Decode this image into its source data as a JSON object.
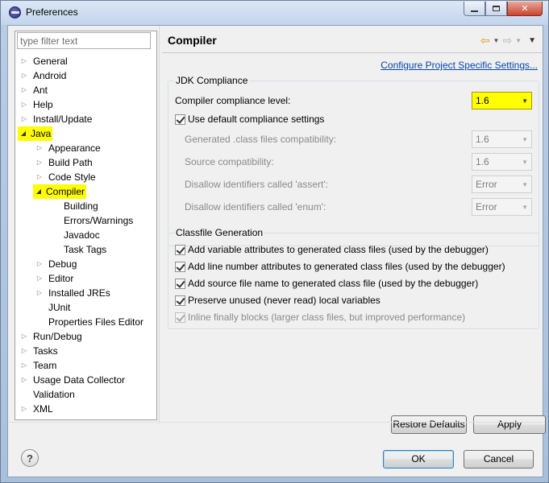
{
  "window": {
    "title": "Preferences",
    "minimize_glyph": "▭",
    "maximize_glyph": "▭",
    "close_glyph": "✕"
  },
  "filter": {
    "placeholder": "type filter text"
  },
  "tree": {
    "items": [
      {
        "label": "General",
        "expander": "▷"
      },
      {
        "label": "Android",
        "expander": "▷"
      },
      {
        "label": "Ant",
        "expander": "▷"
      },
      {
        "label": "Help",
        "expander": "▷"
      },
      {
        "label": "Install/Update",
        "expander": "▷"
      },
      {
        "label": "Java",
        "expander": "◢"
      },
      {
        "label": "Appearance",
        "expander": "▷"
      },
      {
        "label": "Build Path",
        "expander": "▷"
      },
      {
        "label": "Code Style",
        "expander": "▷"
      },
      {
        "label": "Compiler",
        "expander": "◢"
      },
      {
        "label": "Building"
      },
      {
        "label": "Errors/Warnings"
      },
      {
        "label": "Javadoc"
      },
      {
        "label": "Task Tags"
      },
      {
        "label": "Debug",
        "expander": "▷"
      },
      {
        "label": "Editor",
        "expander": "▷"
      },
      {
        "label": "Installed JREs",
        "expander": "▷"
      },
      {
        "label": "JUnit"
      },
      {
        "label": "Properties Files Editor"
      },
      {
        "label": "Run/Debug",
        "expander": "▷"
      },
      {
        "label": "Tasks",
        "expander": "▷"
      },
      {
        "label": "Team",
        "expander": "▷"
      },
      {
        "label": "Usage Data Collector",
        "expander": "▷"
      },
      {
        "label": "Validation"
      },
      {
        "label": "XML",
        "expander": "▷"
      }
    ],
    "highlight_color": "#ffff00"
  },
  "page": {
    "title": "Compiler",
    "back_icon": "⇦",
    "forward_icon": "⇨",
    "menu_caret": "▼",
    "config_link": "Configure Project Specific Settings..."
  },
  "jdk": {
    "group_title": "JDK Compliance",
    "compliance_label": "Compiler compliance level:",
    "compliance_value": "1.6",
    "use_default_label": "Use default compliance settings",
    "use_default_checked": true,
    "rows": [
      {
        "label": "Generated .class files compatibility:",
        "value": "1.6"
      },
      {
        "label": "Source compatibility:",
        "value": "1.6"
      },
      {
        "label": "Disallow identifiers called 'assert':",
        "value": "Error"
      },
      {
        "label": "Disallow identifiers called 'enum':",
        "value": "Error"
      }
    ]
  },
  "classfile": {
    "group_title": "Classfile Generation",
    "options": [
      {
        "label": "Add variable attributes to generated class files (used by the debugger)",
        "checked": true,
        "enabled": true
      },
      {
        "label": "Add line number attributes to generated class files (used by the debugger)",
        "checked": true,
        "enabled": true
      },
      {
        "label": "Add source file name to generated class file (used by the debugger)",
        "checked": true,
        "enabled": true
      },
      {
        "label": "Preserve unused (never read) local variables",
        "checked": true,
        "enabled": true
      },
      {
        "label": "Inline finally blocks (larger class files, but improved performance)",
        "checked": true,
        "enabled": false
      }
    ]
  },
  "buttons": {
    "restore_defaults": "Restore Defaults",
    "apply": "Apply",
    "ok": "OK",
    "cancel": "Cancel",
    "help": "?"
  },
  "colors": {
    "highlight": "#ffff00",
    "link": "#0645ad"
  }
}
